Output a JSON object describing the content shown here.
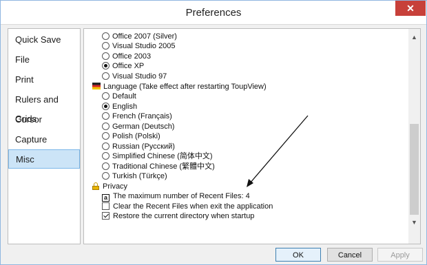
{
  "window": {
    "title": "Preferences",
    "close_glyph": "✕"
  },
  "sidebar": {
    "items": [
      {
        "label": "Quick Save"
      },
      {
        "label": "File"
      },
      {
        "label": "Print"
      },
      {
        "label": "Rulers and Grids"
      },
      {
        "label": "Cursor"
      },
      {
        "label": "Capture"
      },
      {
        "label": "Misc",
        "active": true
      }
    ]
  },
  "misc": {
    "themes": [
      {
        "label": "Office 2007 (Silver)",
        "selected": false
      },
      {
        "label": "Visual Studio 2005",
        "selected": false
      },
      {
        "label": "Office 2003",
        "selected": false
      },
      {
        "label": "Office XP",
        "selected": true
      },
      {
        "label": "Visual Studio 97",
        "selected": false
      }
    ],
    "language_heading": "Language (Take effect after restarting ToupView)",
    "languages": [
      {
        "label": "Default",
        "selected": false
      },
      {
        "label": "English",
        "selected": true
      },
      {
        "label": "French (Français)",
        "selected": false
      },
      {
        "label": "German (Deutsch)",
        "selected": false
      },
      {
        "label": "Polish (Polski)",
        "selected": false
      },
      {
        "label": "Russian (Русский)",
        "selected": false
      },
      {
        "label": "Simplified Chinese (简体中文)",
        "selected": false
      },
      {
        "label": "Traditional Chinese (繁體中文)",
        "selected": false
      },
      {
        "label": "Turkish (Türkçe)",
        "selected": false
      }
    ],
    "privacy_heading": "Privacy",
    "recent_files_icon_text": "a",
    "recent_files_label": "The maximum number of Recent Files: 4",
    "clear_recent_label": "Clear the Recent Files when exit the application",
    "clear_recent_checked": false,
    "restore_dir_label": "Restore the current directory when startup",
    "restore_dir_checked": true
  },
  "buttons": {
    "ok": "OK",
    "cancel": "Cancel",
    "apply": "Apply"
  },
  "colors": {
    "accent": "#cce4f7",
    "close": "#c7403a"
  }
}
